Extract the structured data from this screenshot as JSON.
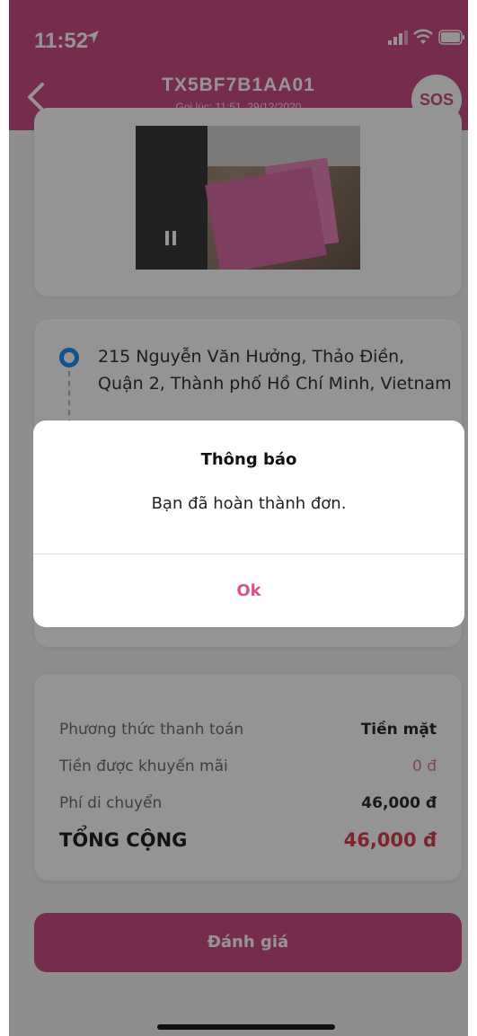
{
  "status_bar": {
    "time": "11:52",
    "icons": [
      "location-arrow-icon",
      "signal-icon",
      "wifi-icon",
      "battery-icon"
    ]
  },
  "header": {
    "order_code": "TX5BF7B1AA01",
    "order_time": "Gọi lúc: 11:51, 29/12/2020",
    "sos_label": "SOS",
    "back_icon": "chevron-left-icon"
  },
  "address": {
    "pickup": "215 Nguyễn Văn Hưởng, Thảo Điền, Quận 2, Thành phố Hồ Chí Minh, Vietnam"
  },
  "payment": {
    "method_label": "Phương thức thanh toán",
    "method_value": "Tiền mặt",
    "discount_label": "Tiền được khuyến mãi",
    "discount_value": "0 đ",
    "fee_label": "Phí di chuyển",
    "fee_value": "46,000 đ",
    "total_label": "TỔNG CỘNG",
    "total_value": "46,000 đ"
  },
  "actions": {
    "rate_label": "Đánh giá"
  },
  "alert": {
    "title": "Thông báo",
    "message": "Bạn đã hoàn thành đơn.",
    "ok_label": "Ok"
  },
  "colors": {
    "brand": "#cc4f86",
    "ok_text": "#e0508a",
    "total": "#d6404a",
    "discount": "#e57a8a",
    "pin": "#1f8ff0"
  }
}
